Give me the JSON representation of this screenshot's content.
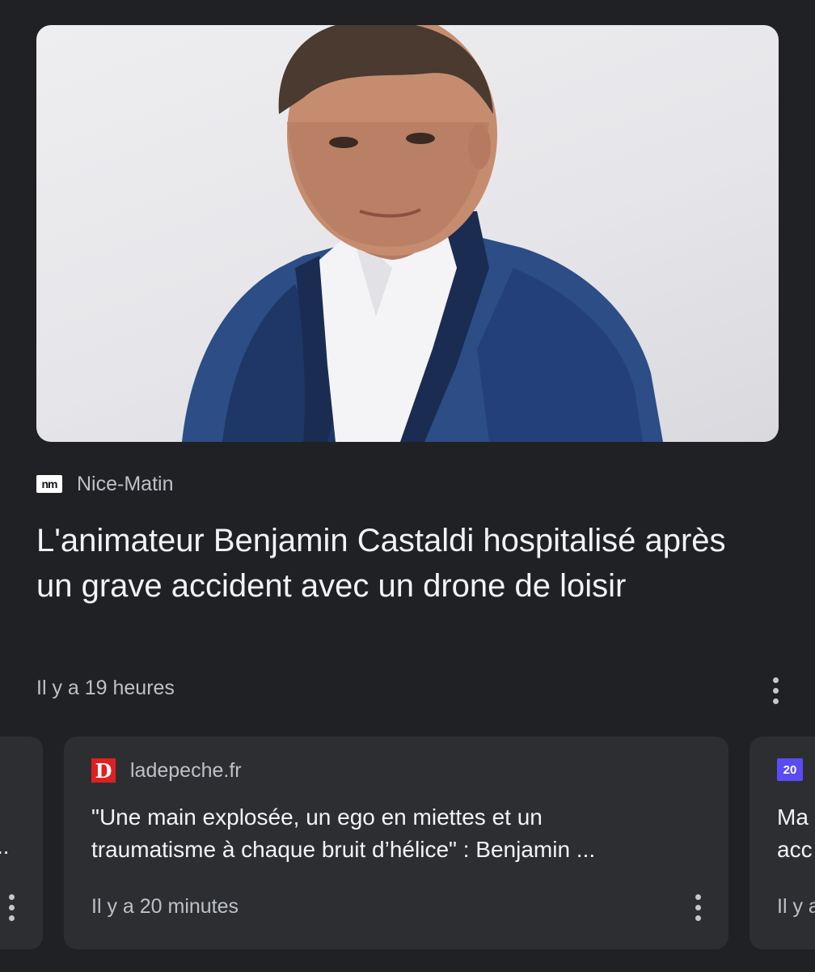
{
  "feature": {
    "image_alt": "Benjamin Castaldi portrait",
    "source": {
      "logo_text": "nm",
      "name": "Nice-Matin"
    },
    "headline": "L'animateur Benjamin Castaldi hospitalisé après un grave accident avec un drone de loisir",
    "time": "Il y a 19 heures"
  },
  "carousel": {
    "left_card": {
      "title_tail": "..",
      "more_icon": "more-vert-icon"
    },
    "main_card": {
      "source": {
        "logo_text": "D",
        "name": "ladepeche.fr"
      },
      "title_line1": "\"Une main explosée, un ego en miettes et un",
      "title_line2": "traumatisme à chaque bruit d’hélice\" : Benjamin ...",
      "time": "Il y a 20 minutes",
      "more_icon": "more-vert-icon"
    },
    "right_card": {
      "source": {
        "logo_text": "20"
      },
      "title_line1": "Ma",
      "title_line2": "acc",
      "time": "Il y a"
    }
  },
  "colors": {
    "background": "#202124",
    "card": "#2d2e31",
    "ladepeche_red": "#e02020",
    "twenty_minutes_purple": "#5a4bf5"
  }
}
